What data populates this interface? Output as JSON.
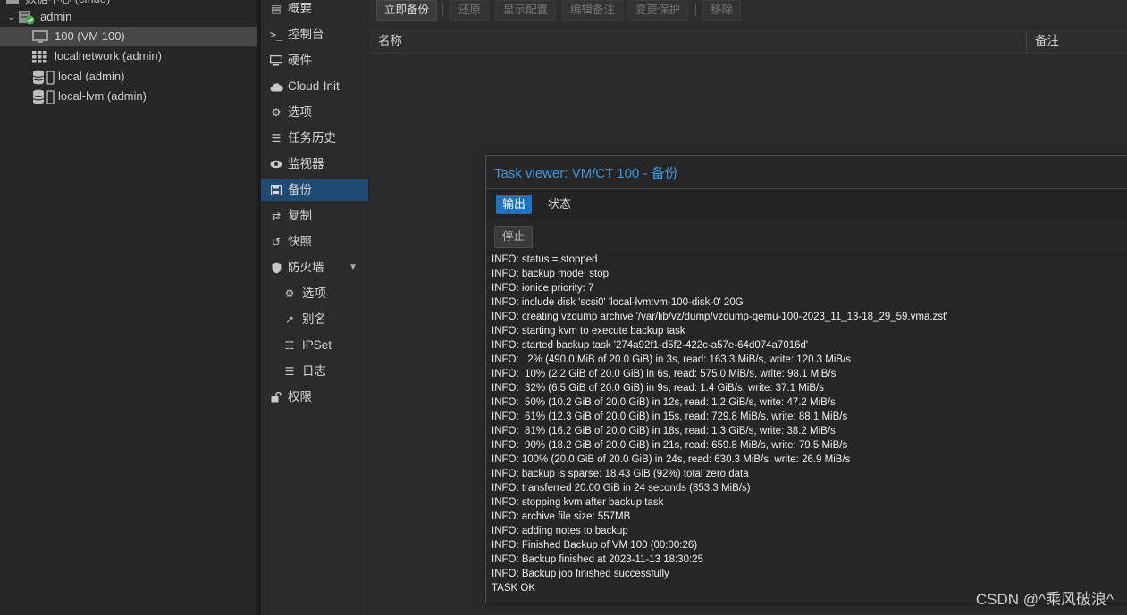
{
  "tree": {
    "top_partial": "数据中心 (cindo)",
    "items": [
      {
        "label": "admin",
        "icon": "server-online-icon"
      },
      {
        "label": "100 (VM 100)",
        "icon": "monitor-icon"
      },
      {
        "label": "localnetwork (admin)",
        "icon": "network-grid-icon"
      },
      {
        "label": "local (admin)",
        "icon": "storage-database-icon"
      },
      {
        "label": "local-lvm (admin)",
        "icon": "storage-database-icon"
      }
    ]
  },
  "vm_menu": {
    "items": [
      {
        "label": "概要",
        "icon": "summary-icon"
      },
      {
        "label": "控制台",
        "icon": "terminal-icon"
      },
      {
        "label": "硬件",
        "icon": "desktop-icon"
      },
      {
        "label": "Cloud-Init",
        "icon": "cloud-icon"
      },
      {
        "label": "选项",
        "icon": "gear-icon"
      },
      {
        "label": "任务历史",
        "icon": "list-icon"
      },
      {
        "label": "监视器",
        "icon": "eye-icon"
      },
      {
        "label": "备份",
        "icon": "floppy-icon"
      },
      {
        "label": "复制",
        "icon": "retweet-icon"
      },
      {
        "label": "快照",
        "icon": "history-icon"
      },
      {
        "label": "防火墙",
        "icon": "shield-icon"
      },
      {
        "label": "选项",
        "icon": "gear-icon"
      },
      {
        "label": "别名",
        "icon": "external-link-icon"
      },
      {
        "label": "IPSet",
        "icon": "list-ol-icon"
      },
      {
        "label": "日志",
        "icon": "list-icon"
      },
      {
        "label": "权限",
        "icon": "unlock-icon"
      }
    ],
    "active_label": "备份"
  },
  "toolbar": {
    "backup_now": "立即备份",
    "restore": "还原",
    "show_config": "显示配置",
    "edit_notes": "编辑备注",
    "change_protection": "变更保护",
    "remove": "移除"
  },
  "grid": {
    "col_name": "名称",
    "col_notes": "备注"
  },
  "task_viewer": {
    "title": "Task viewer: VM/CT 100 - 备份",
    "tab_output": "输出",
    "tab_status": "状态",
    "stop_button": "停止",
    "log": [
      "INFO: status = stopped",
      "INFO: backup mode: stop",
      "INFO: ionice priority: 7",
      "INFO: include disk 'scsi0' 'local-lvm:vm-100-disk-0' 20G",
      "INFO: creating vzdump archive '/var/lib/vz/dump/vzdump-qemu-100-2023_11_13-18_29_59.vma.zst'",
      "INFO: starting kvm to execute backup task",
      "INFO: started backup task '274a92f1-d5f2-422c-a57e-64d074a7016d'",
      "INFO:   2% (490.0 MiB of 20.0 GiB) in 3s, read: 163.3 MiB/s, write: 120.3 MiB/s",
      "INFO:  10% (2.2 GiB of 20.0 GiB) in 6s, read: 575.0 MiB/s, write: 98.1 MiB/s",
      "INFO:  32% (6.5 GiB of 20.0 GiB) in 9s, read: 1.4 GiB/s, write: 37.1 MiB/s",
      "INFO:  50% (10.2 GiB of 20.0 GiB) in 12s, read: 1.2 GiB/s, write: 47.2 MiB/s",
      "INFO:  61% (12.3 GiB of 20.0 GiB) in 15s, read: 729.8 MiB/s, write: 88.1 MiB/s",
      "INFO:  81% (16.2 GiB of 20.0 GiB) in 18s, read: 1.3 GiB/s, write: 38.2 MiB/s",
      "INFO:  90% (18.2 GiB of 20.0 GiB) in 21s, read: 659.8 MiB/s, write: 79.5 MiB/s",
      "INFO: 100% (20.0 GiB of 20.0 GiB) in 24s, read: 630.3 MiB/s, write: 26.9 MiB/s",
      "INFO: backup is sparse: 18.43 GiB (92%) total zero data",
      "INFO: transferred 20.00 GiB in 24 seconds (853.3 MiB/s)",
      "INFO: stopping kvm after backup task",
      "INFO: archive file size: 557MB",
      "INFO: adding notes to backup",
      "INFO: Finished Backup of VM 100 (00:00:26)",
      "INFO: Backup finished at 2023-11-13 18:30:25",
      "INFO: Backup job finished successfully",
      "TASK OK"
    ]
  },
  "watermark": "CSDN @^乘风破浪^",
  "colors": {
    "accent": "#3d9ae3",
    "active_menu": "#1f4a73",
    "active_tab": "#1a73c4",
    "online_green": "#3fae49"
  }
}
